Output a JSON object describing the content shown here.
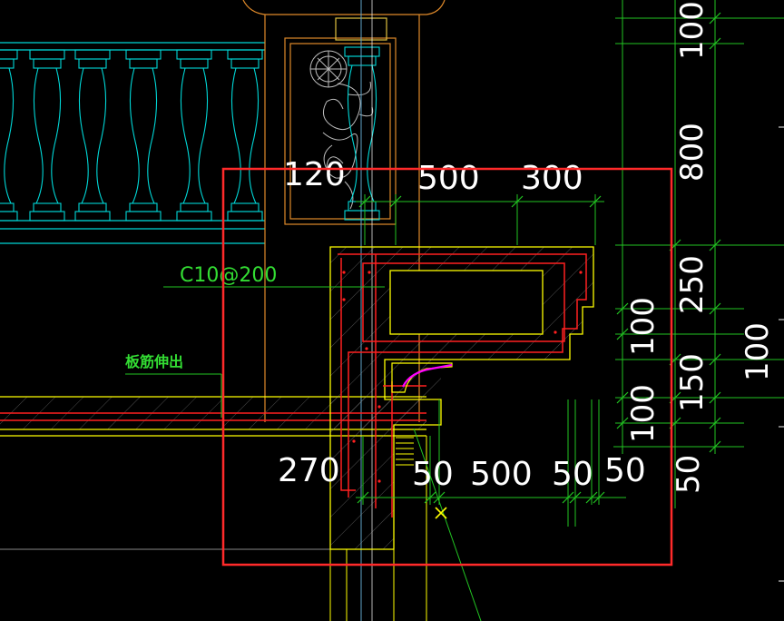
{
  "drawing": {
    "colors": {
      "background": "#000000",
      "balustrade": "#00d7d7",
      "slab": "#ffff00",
      "rebar": "#ff2020",
      "dimension": "#22c422",
      "text": "#ffffff",
      "selection": "#ff2a2a",
      "ornament": "#e08a2a",
      "accent": "#ff00ff",
      "cursor": "#ffff00"
    },
    "annotations": {
      "rebar_spec": "C10@200",
      "slab_rebar_note": "板筋伸出"
    },
    "dimensions": {
      "top": {
        "d1": "120",
        "d2": "500",
        "d3": "300"
      },
      "bottom": {
        "d1": "270",
        "d2": "50",
        "d3": "500",
        "d4": "50",
        "d5": "50"
      },
      "right_inner": {
        "d1": "100",
        "d2": "100"
      },
      "right_outer": {
        "d1": "100",
        "d2": "800",
        "d3": "250",
        "d4": "150",
        "d5": "50"
      },
      "far_right": {
        "d1": "100"
      }
    }
  }
}
